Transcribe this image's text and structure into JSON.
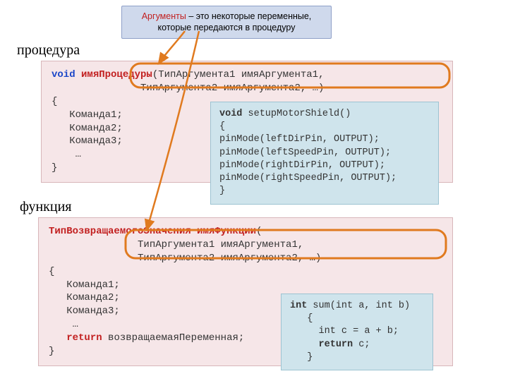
{
  "callout": {
    "highlight": "Аргументы",
    "rest": " – это некоторые переменные, которые передаются в процедуру"
  },
  "headings": {
    "procedure": "процедура",
    "function": "функция"
  },
  "procedure_block": {
    "l1a": "void",
    "l1b": "имяПроцедуры",
    "l1c": "(ТипАргумента1 имяАргумента1,",
    "l2": "               ТипАргумента2 имяАргумента2, …)",
    "l3": "{",
    "l4": "   Команда1;",
    "l5": "   Команда2;",
    "l6": "   Команда3;",
    "l7": "    …",
    "l8": "}"
  },
  "procedure_example": {
    "l1a": "void",
    "l1b": " setupMotorShield()",
    "l2": "{",
    "l3": "pinMode(leftDirPin, OUTPUT);",
    "l4": "pinMode(leftSpeedPin, OUTPUT);",
    "l5": "pinMode(rightDirPin, OUTPUT);",
    "l6": "pinMode(rightSpeedPin, OUTPUT);",
    "l7": "}"
  },
  "function_block": {
    "l1a": "ТипВозвращаемогоЗначения",
    "l1b": "имяФункции",
    "l1c": "(",
    "l2": "               ТипАргумента1 имяАргумента1,",
    "l3": "               ТипАргумента2 имяАргумента2, …)",
    "l4": "{",
    "l5": "   Команда1;",
    "l6": "   Команда2;",
    "l7": "   Команда3;",
    "l8": "    …",
    "l9a": "   ",
    "l9b": "return",
    "l9c": " возвращаемаяПеременная;",
    "l10": "}"
  },
  "function_example": {
    "l1a": "int",
    "l1b": " sum(int a, int b)",
    "l2": "   {",
    "l3": "     int c = a + b;",
    "l4a": "     ",
    "l4b": "return",
    "l4c": " c;",
    "l5": "   }"
  }
}
